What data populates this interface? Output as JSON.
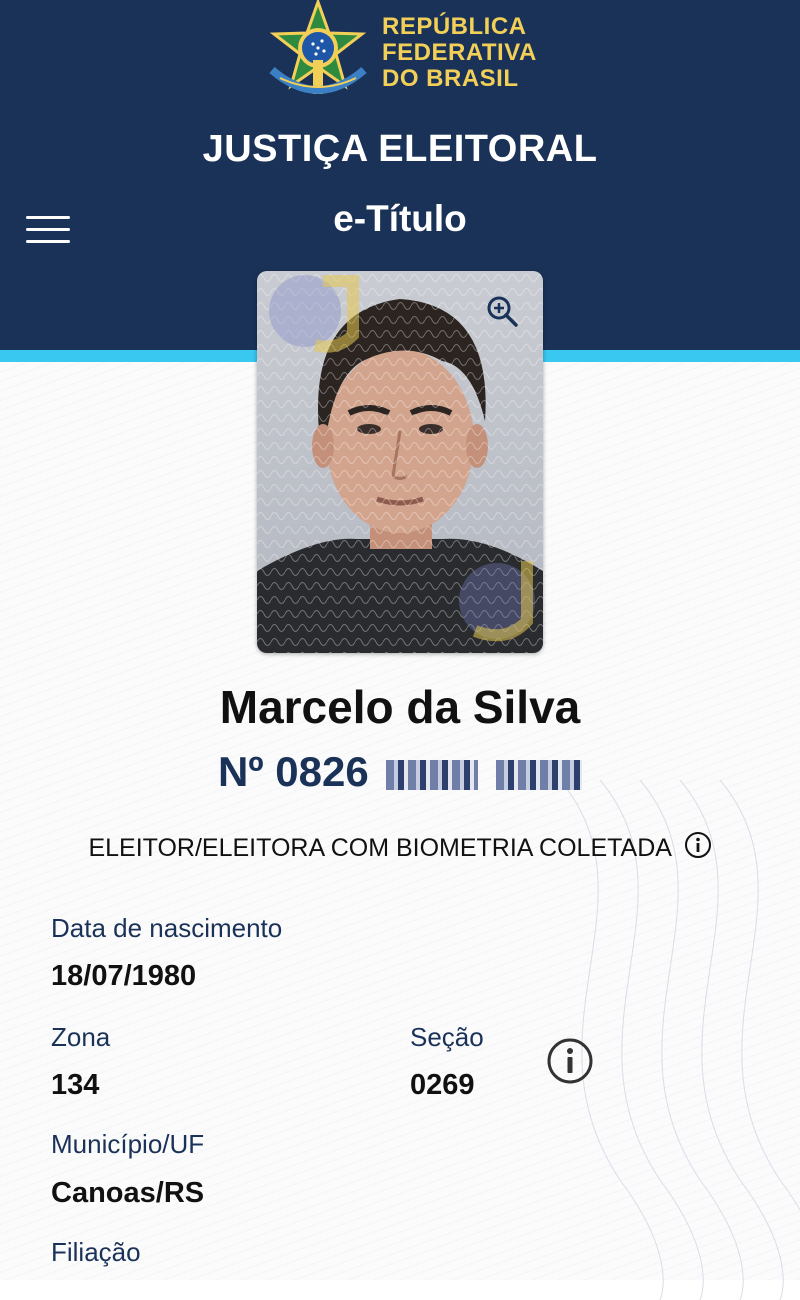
{
  "header": {
    "gov_title_lines": [
      "REPÚBLICA",
      "FEDERATIVA",
      "DO BRASIL"
    ],
    "agency": "JUSTIÇA ELEITORAL",
    "app_title": "e-Título",
    "colors": {
      "navy": "#1b3258",
      "gold": "#f2cf57",
      "cyan": "#38c8f0"
    }
  },
  "voter": {
    "name": "Marcelo da Silva",
    "number_prefix": "Nº 0826",
    "biometry_status": "ELEITOR/ELEITORA COM BIOMETRIA COLETADA"
  },
  "fields": {
    "birth": {
      "label": "Data de nascimento",
      "value": "18/07/1980"
    },
    "zona": {
      "label": "Zona",
      "value": "134"
    },
    "secao": {
      "label": "Seção",
      "value": "0269"
    },
    "municipio": {
      "label": "Município/UF",
      "value": "Canoas/RS"
    },
    "filiacao": {
      "label": "Filiação"
    }
  },
  "icons": [
    "menu-icon",
    "zoom-in-icon",
    "info-icon",
    "coat-of-arms-icon"
  ]
}
